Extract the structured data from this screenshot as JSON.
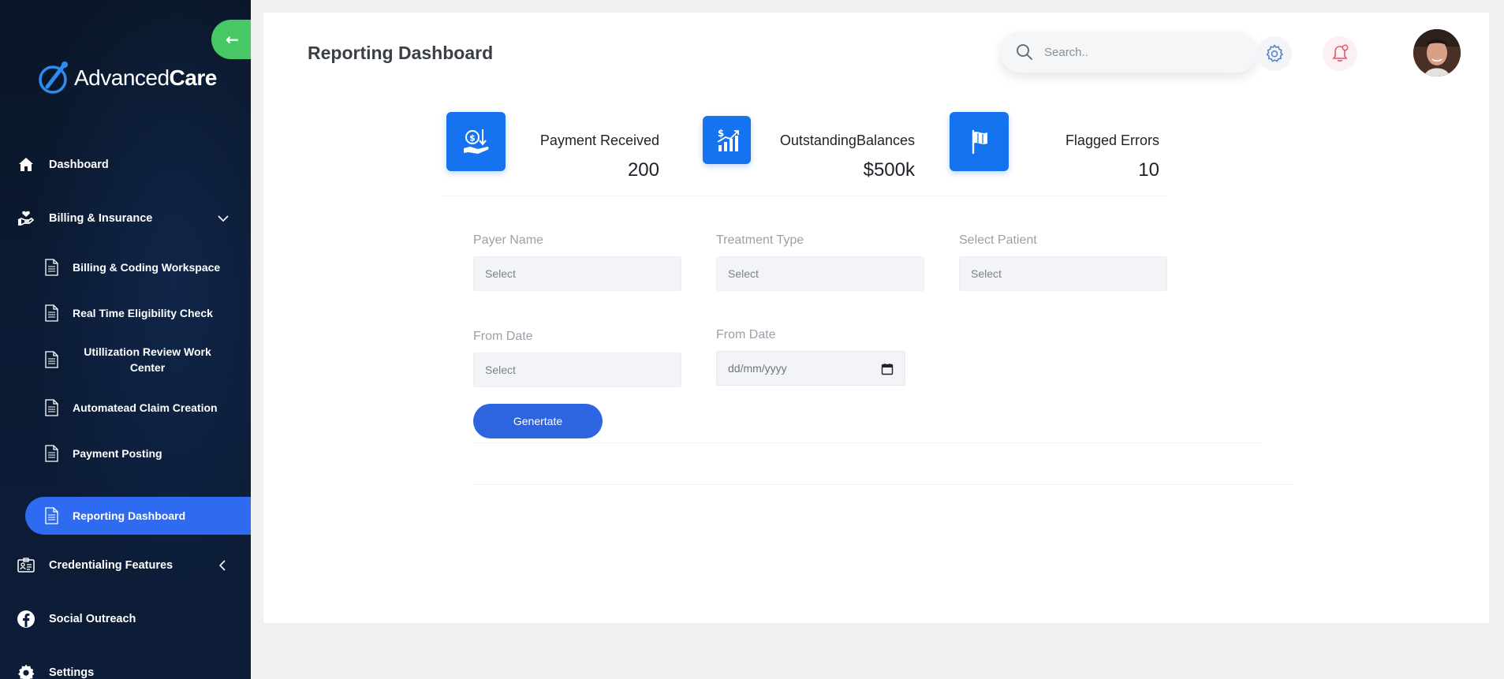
{
  "app": {
    "brand_regular": "Advanced",
    "brand_bold": "Care"
  },
  "sidebar": {
    "items": [
      {
        "label": "Dashboard",
        "icon": "home-icon"
      },
      {
        "label": "Billing & Insurance",
        "icon": "hand-heart-icon",
        "expanded": true,
        "children": [
          {
            "label": "Billing & Coding Workspace",
            "icon": "document-icon"
          },
          {
            "label": "Real Time Eligibility Check",
            "icon": "document-icon"
          },
          {
            "label": "Utillization Review Work",
            "label_line2": "Center",
            "icon": "document-icon"
          },
          {
            "label": "Automatead Claim Creation",
            "icon": "document-icon"
          },
          {
            "label": "Payment Posting",
            "icon": "document-icon"
          },
          {
            "label": "Reporting Dashboard",
            "icon": "document-icon",
            "active": true
          }
        ]
      },
      {
        "label": "Credentialing Features",
        "icon": "id-card-icon",
        "expanded": false
      },
      {
        "label": "Social Outreach",
        "icon": "facebook-icon"
      },
      {
        "label": "Settings",
        "icon": "gear-icon"
      }
    ]
  },
  "header": {
    "title": "Reporting Dashboard",
    "search_placeholder": "Search.."
  },
  "stats": [
    {
      "label": "Payment Received",
      "value": "200",
      "icon": "dollar-hand-icon"
    },
    {
      "label": "OutstandingBalances",
      "value": "$500k",
      "icon": "growth-chart-icon"
    },
    {
      "label": "Flagged Errors",
      "value": "10",
      "icon": "flag-icon"
    }
  ],
  "form": {
    "payer_name_label": "Payer Name",
    "payer_name_value": "Select",
    "treatment_type_label": "Treatment Type",
    "treatment_type_value": "Select",
    "select_patient_label": "Select Patient",
    "select_patient_value": "Select",
    "from_date_label": "From Date",
    "from_date_value": "Select",
    "from_date2_label": "From Date",
    "from_date2_placeholder": "dd/mm/yyyy",
    "generate_label": "Genertate"
  },
  "colors": {
    "sidebar_bg": "#0b1a33",
    "accent_blue": "#1573f0",
    "active_item": "#2f6bf0",
    "collapse_green": "#48c864",
    "button_blue": "#2f64e0"
  }
}
